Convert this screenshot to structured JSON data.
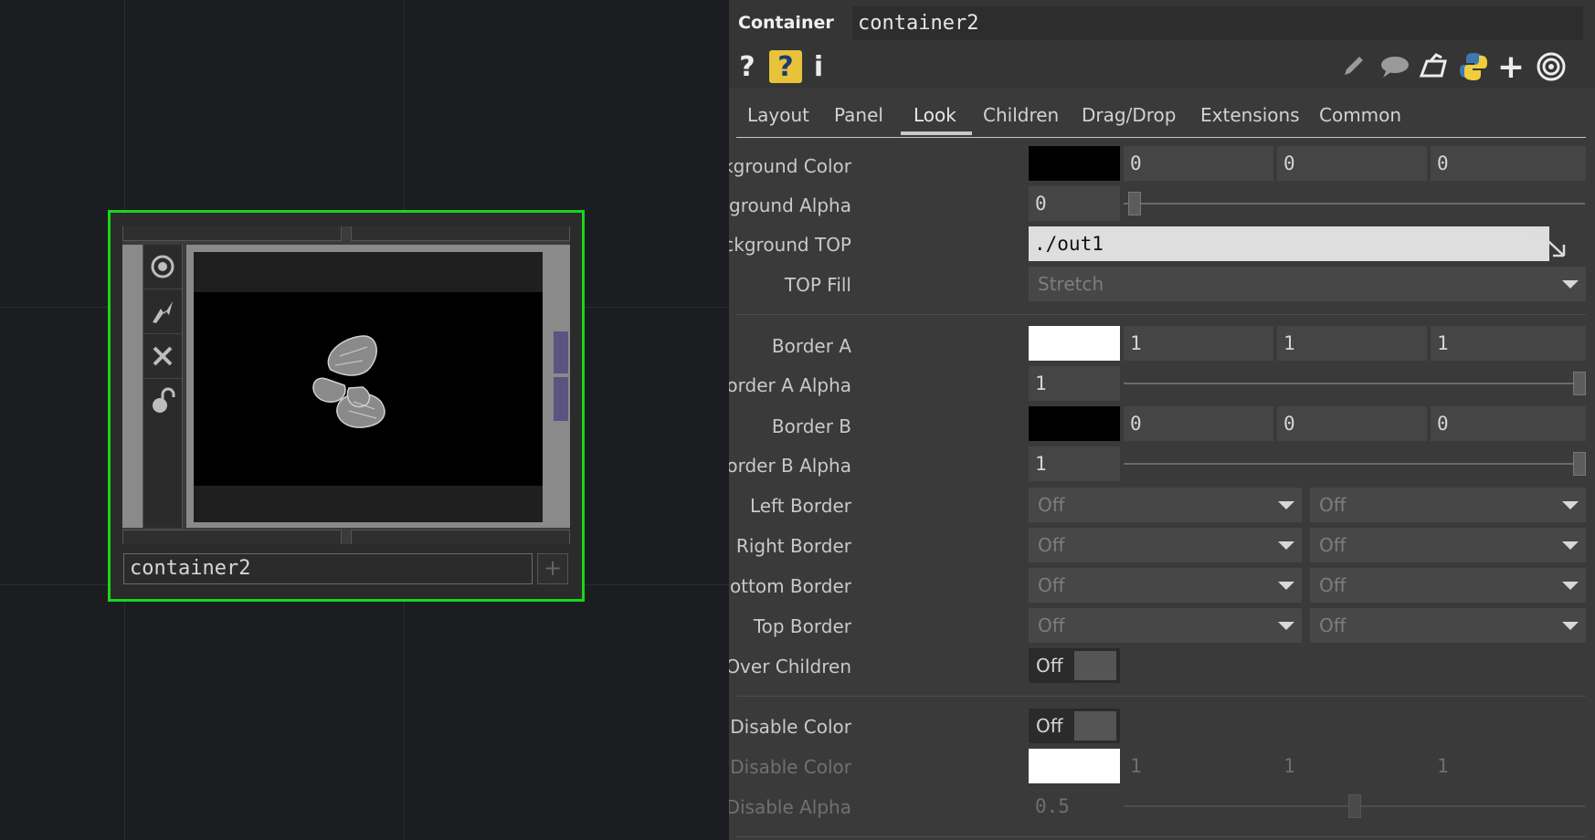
{
  "node": {
    "name": "container2",
    "viewer_icons": [
      "target-icon",
      "lightning-icon",
      "close-icon",
      "lock-open-icon"
    ]
  },
  "panel": {
    "op_type": "Container",
    "op_name": "container2",
    "toolbar": {
      "help_glyph": "?",
      "help_python_glyph": "?",
      "info_glyph": "i",
      "right_icons": [
        "pencil-icon",
        "comment-icon",
        "clone-icon",
        "python-icon",
        "plus-icon",
        "viewer-icon"
      ]
    },
    "tabs": [
      "Layout",
      "Panel",
      "Look",
      "Children",
      "Drag/Drop",
      "Extensions",
      "Common"
    ],
    "active_tab": "Look",
    "params": {
      "bg_color": {
        "label": "Background Color",
        "swatch": "#000000",
        "r": "0",
        "g": "0",
        "b": "0"
      },
      "bg_alpha": {
        "label": "Background Alpha",
        "value": "0",
        "level": 0
      },
      "bg_top": {
        "label": "Background TOP",
        "value": "./out1"
      },
      "top_fill": {
        "label": "TOP Fill",
        "value": "Stretch"
      },
      "border_a": {
        "label": "Border A",
        "swatch": "#ffffff",
        "r": "1",
        "g": "1",
        "b": "1"
      },
      "border_a_alpha": {
        "label": "Border A Alpha",
        "value": "1",
        "level": 1
      },
      "border_b": {
        "label": "Border B",
        "swatch": "#000000",
        "r": "0",
        "g": "0",
        "b": "0"
      },
      "border_b_alpha": {
        "label": "Border B Alpha",
        "value": "1",
        "level": 1
      },
      "left_border": {
        "label": "Left Border",
        "a": "Off",
        "b": "Off"
      },
      "right_border": {
        "label": "Right Border",
        "a": "Off",
        "b": "Off"
      },
      "bottom_border": {
        "label": "Bottom Border",
        "a": "Off",
        "b": "Off"
      },
      "top_border": {
        "label": "Top Border",
        "a": "Off",
        "b": "Off"
      },
      "border_over_children": {
        "label": "Border Over Children",
        "value": "Off"
      },
      "disable_color_toggle": {
        "label": "Disable Color",
        "value": "Off"
      },
      "disable_color": {
        "label": "Disable Color",
        "swatch": "#ffffff",
        "r": "1",
        "g": "1",
        "b": "1"
      },
      "disable_alpha": {
        "label": "Disable Alpha",
        "value": "0.5",
        "level": 0.5
      }
    }
  }
}
